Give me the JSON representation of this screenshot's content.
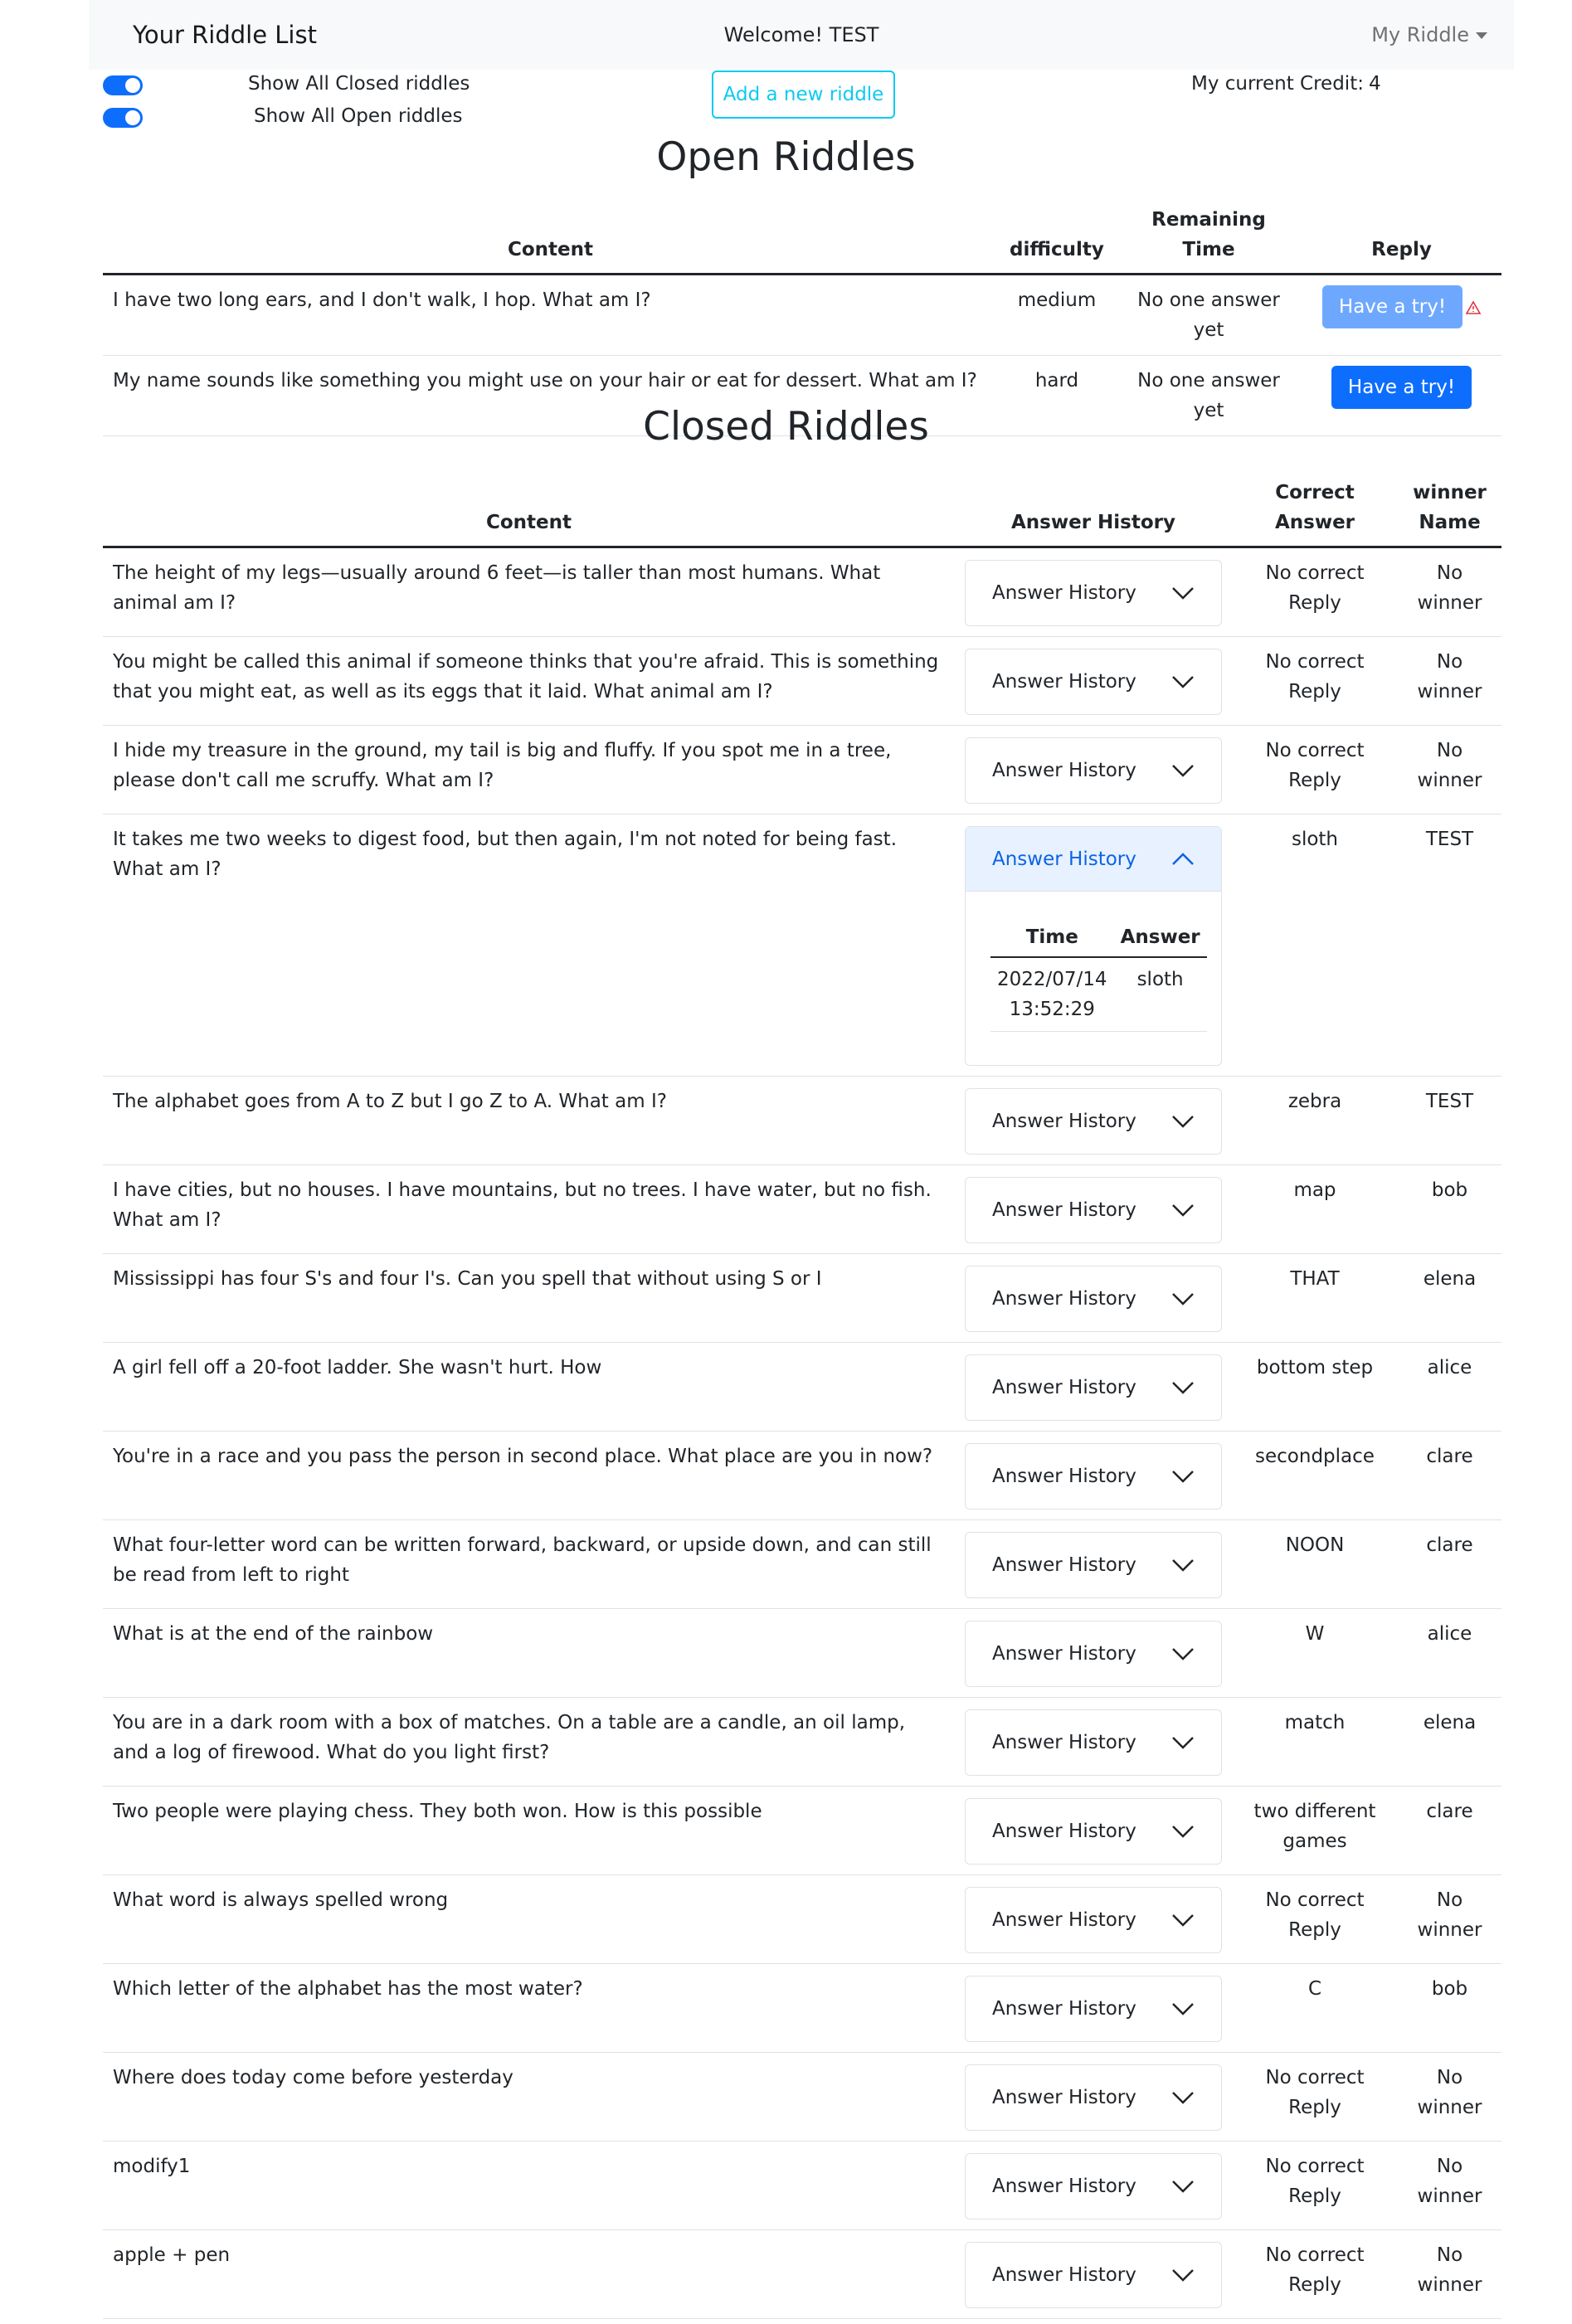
{
  "navbar": {
    "brand": "Your Riddle List",
    "welcome": "Welcome! TEST",
    "user_menu": "My Riddle"
  },
  "controls": {
    "toggle_closed_label": "Show All Closed riddles",
    "toggle_open_label": "Show All Open riddles",
    "toggle_closed_on": true,
    "toggle_open_on": true,
    "add_button": "Add a new riddle",
    "credit_label": "My current Credit:",
    "credit_value": "4"
  },
  "open_section": {
    "title": "Open Riddles",
    "headers": {
      "content": "Content",
      "difficulty": "difficulty",
      "remaining": "Remaining Time",
      "reply": "Reply"
    },
    "rows": [
      {
        "content": "I have two long ears, and I don't walk, I hop. What am I?",
        "difficulty": "medium",
        "remaining": "No one answer yet",
        "reply_label": "Have a try!",
        "disabled": true
      },
      {
        "content": "My name sounds like something you might use on your hair or eat for dessert. What am I?",
        "difficulty": "hard",
        "remaining": "No one answer yet",
        "reply_label": "Have a try!",
        "disabled": false
      }
    ]
  },
  "closed_section": {
    "title": "Closed Riddles",
    "headers": {
      "content": "Content",
      "history": "Answer History",
      "correct": "Correct Answer",
      "winner": "winner Name"
    },
    "accordion_label": "Answer History",
    "history_headers": {
      "time": "Time",
      "answer": "Answer"
    },
    "rows": [
      {
        "content": "The height of my legs—usually around 6 feet—is taller than most humans. What animal am I?",
        "correct": "No correct Reply",
        "winner": "No winner"
      },
      {
        "content": "You might be called this animal if someone thinks that you're afraid. This is something that you might eat, as well as its eggs that it laid. What animal am I?",
        "correct": "No correct Reply",
        "winner": "No winner"
      },
      {
        "content": "I hide my treasure in the ground, my tail is big and fluffy. If you spot me in a tree, please don't call me scruffy. What am I?",
        "correct": "No correct Reply",
        "winner": "No winner"
      },
      {
        "content": "It takes me two weeks to digest food, but then again, I'm not noted for being fast. What am I?",
        "correct": "sloth",
        "winner": "TEST",
        "history": [
          {
            "time": "2022/07/14 13:52:29",
            "answer": "sloth"
          }
        ]
      },
      {
        "content": "The alphabet goes from A to Z but I go Z to A. What am I?",
        "correct": "zebra",
        "winner": "TEST"
      },
      {
        "content": "I have cities, but no houses. I have mountains, but no trees. I have water, but no fish. What am I?",
        "correct": "map",
        "winner": "bob"
      },
      {
        "content": "Mississippi has four S's and four I's. Can you spell that without using S or I",
        "correct": "THAT",
        "winner": "elena"
      },
      {
        "content": "A girl fell off a 20-foot ladder. She wasn't hurt. How",
        "correct": "bottom step",
        "winner": "alice"
      },
      {
        "content": "You're in a race and you pass the person in second place. What place are you in now?",
        "correct": "secondplace",
        "winner": "clare"
      },
      {
        "content": "What four-letter word can be written forward, backward, or upside down, and can still be read from left to right",
        "correct": "NOON",
        "winner": "clare"
      },
      {
        "content": "What is at the end of the rainbow",
        "correct": "W",
        "winner": "alice"
      },
      {
        "content": "You are in a dark room with a box of matches. On a table are a candle, an oil lamp, and a log of firewood. What do you light first?",
        "correct": "match",
        "winner": "elena"
      },
      {
        "content": "Two people were playing chess. They both won. How is this possible",
        "correct": "two different games",
        "winner": "clare"
      },
      {
        "content": "What word is always spelled wrong",
        "correct": "No correct Reply",
        "winner": "No winner"
      },
      {
        "content": "Which letter of the alphabet has the most water?",
        "correct": "C",
        "winner": "bob"
      },
      {
        "content": "Where does today come before yesterday",
        "correct": "No correct Reply",
        "winner": "No winner"
      },
      {
        "content": "modify1",
        "correct": "No correct Reply",
        "winner": "No winner"
      },
      {
        "content": "apple + pen",
        "correct": "No correct Reply",
        "winner": "No winner"
      }
    ]
  },
  "colors": {
    "primary": "#0d6efd",
    "primary_disabled": "#6ea8fe",
    "info": "#0dcaf0",
    "accordion_open_bg": "#e7f1ff",
    "accordion_open_text": "#0c63e4",
    "warning_icon": "#dc3545"
  }
}
